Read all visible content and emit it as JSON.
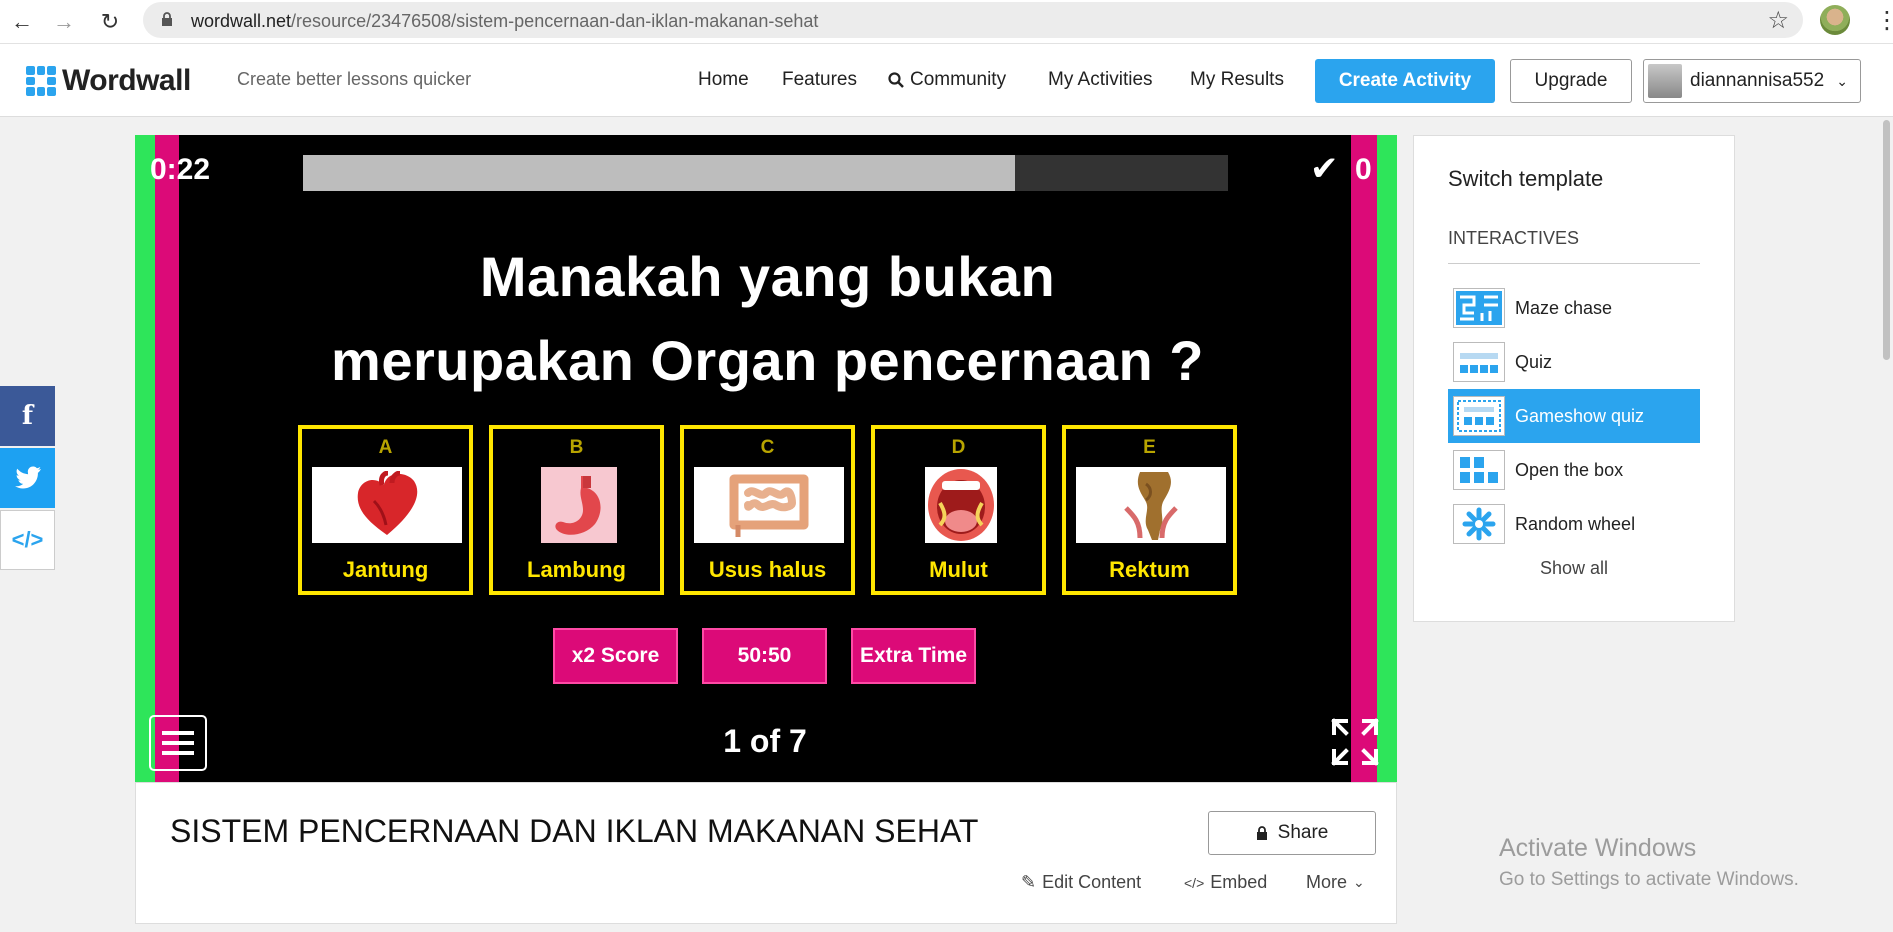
{
  "browser": {
    "url_host": "wordwall.net",
    "url_path": "/resource/23476508/sistem-pencernaan-dan-iklan-makanan-sehat"
  },
  "header": {
    "logo": "Wordwall",
    "tagline": "Create better lessons quicker",
    "nav": [
      "Home",
      "Features",
      "Community",
      "My Activities",
      "My Results"
    ],
    "create_label": "Create Activity",
    "upgrade_label": "Upgrade",
    "username": "diannannisa552"
  },
  "share_bar": {
    "icons": [
      "facebook-icon",
      "twitter-icon",
      "embed-code-icon"
    ]
  },
  "game": {
    "timer": "0:22",
    "time_remaining_fraction": 0.77,
    "score": "0",
    "question_line1": "Manakah yang bukan",
    "question_line2": "merupakan Organ pencernaan ?",
    "answers": [
      {
        "letter": "A",
        "label": "Jantung"
      },
      {
        "letter": "B",
        "label": "Lambung"
      },
      {
        "letter": "C",
        "label": "Usus halus"
      },
      {
        "letter": "D",
        "label": "Mulut"
      },
      {
        "letter": "E",
        "label": "Rektum"
      }
    ],
    "powerups": [
      "x2 Score",
      "50:50",
      "Extra Time"
    ],
    "page_indicator": "1 of 7",
    "colors": {
      "answer_border": "#ffe600",
      "powerup": "#dc0a78",
      "stripe_green": "#2ee55a",
      "stripe_pink": "#dc0a78"
    }
  },
  "activity": {
    "title": "SISTEM PENCERNAAN DAN IKLAN MAKANAN SEHAT",
    "share_label": "Share",
    "edit_label": "Edit Content",
    "embed_label": "Embed",
    "more_label": "More"
  },
  "templates": {
    "title": "Switch template",
    "section": "INTERACTIVES",
    "items": [
      "Maze chase",
      "Quiz",
      "Gameshow quiz",
      "Open the box",
      "Random wheel"
    ],
    "selected": "Gameshow quiz",
    "show_all": "Show all"
  },
  "watermark": {
    "line1": "Activate Windows",
    "line2": "Go to Settings to activate Windows."
  }
}
